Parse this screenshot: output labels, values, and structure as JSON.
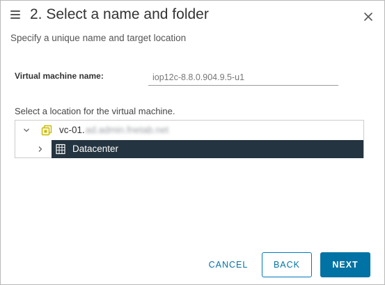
{
  "dialog": {
    "title": "2. Select a name and folder",
    "subtitle": "Specify a unique name and target location"
  },
  "form": {
    "vm_name_label": "Virtual machine name:",
    "vm_name_value": "iop12c-8.8.0.904.9.5-u1",
    "location_label": "Select a location for the virtual machine."
  },
  "tree": {
    "root": {
      "label": "vc-01.",
      "label_obscured": "ad.admin.fnetab.net",
      "expanded": true,
      "icon": "vcenter-icon"
    },
    "child": {
      "label": "Datacenter",
      "expanded": false,
      "selected": true,
      "icon": "datacenter-icon"
    }
  },
  "buttons": {
    "cancel": "CANCEL",
    "back": "BACK",
    "next": "NEXT"
  },
  "colors": {
    "primary": "#0072a3",
    "selected_row": "#243440",
    "vcenter_icon": "#c7b800"
  }
}
